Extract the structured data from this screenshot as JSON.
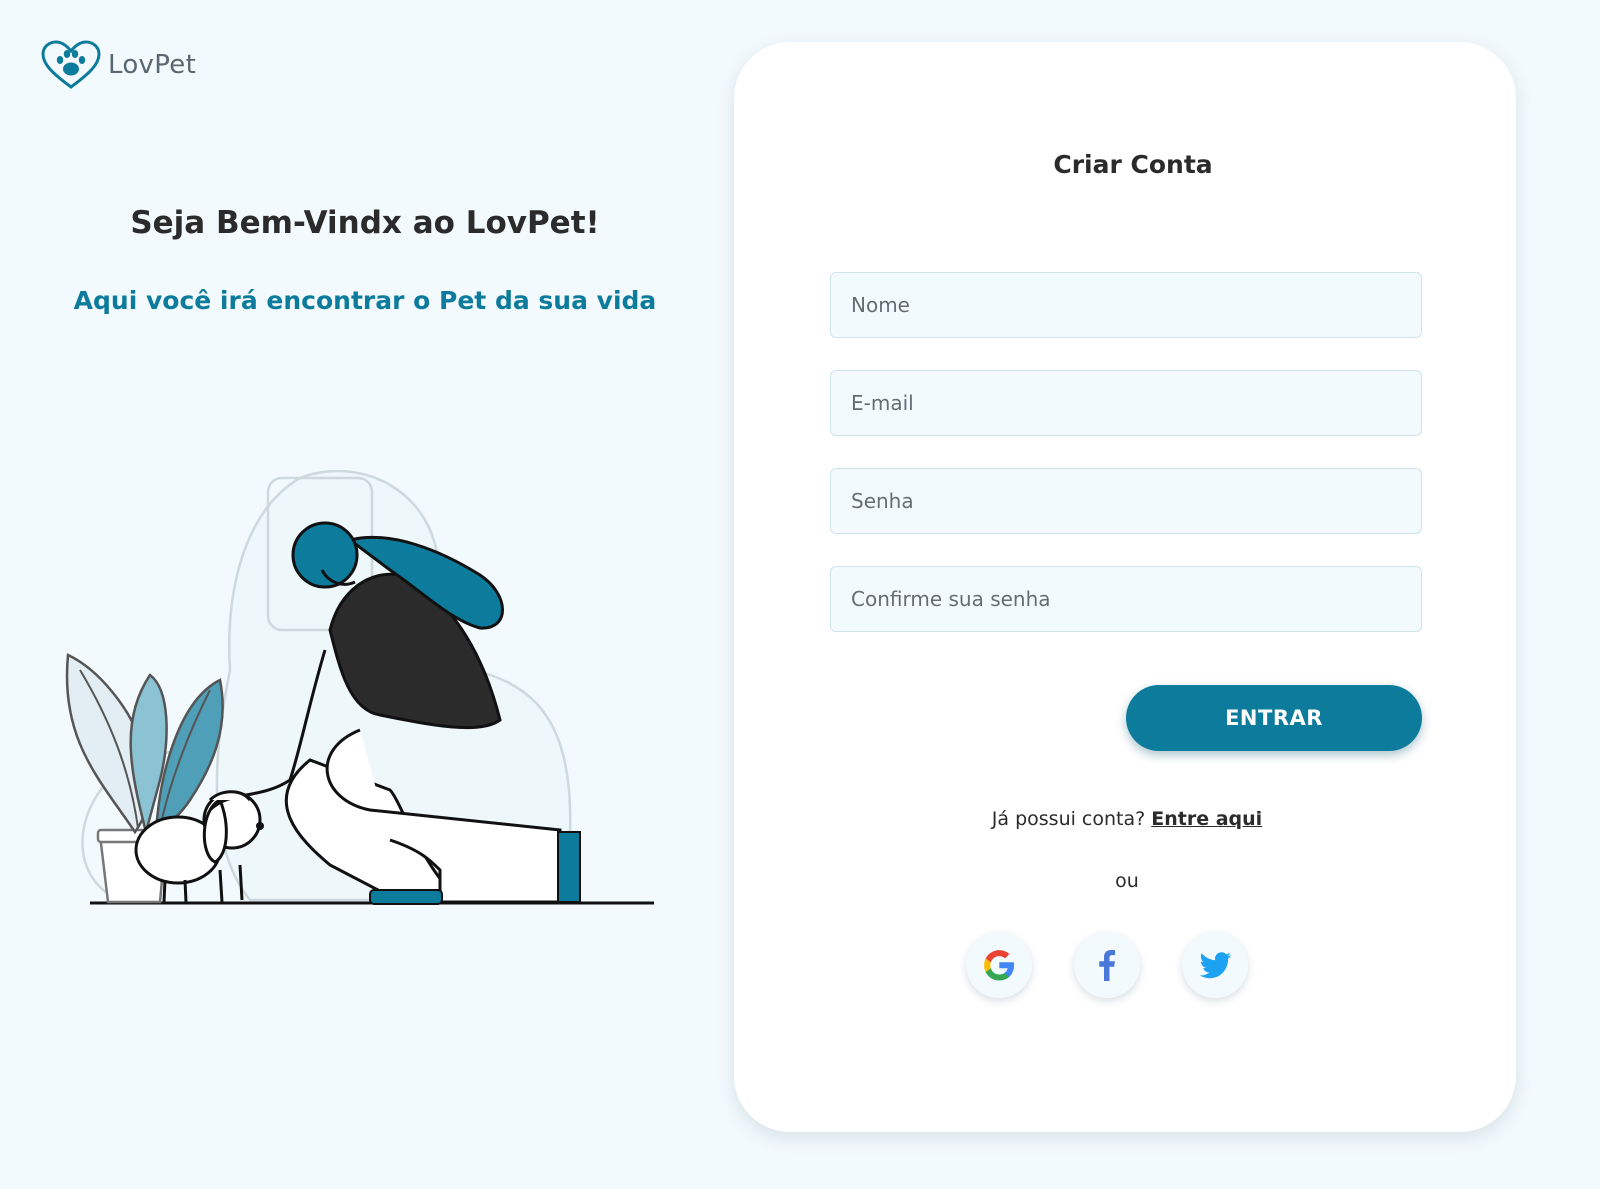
{
  "brand": {
    "name": "LovPet",
    "color": "#0d7b9b"
  },
  "welcome": {
    "title": "Seja Bem-Vindx ao LovPet!",
    "subtitle": "Aqui você irá encontrar o Pet da sua vida"
  },
  "form": {
    "title": "Criar Conta",
    "fields": [
      {
        "placeholder": "Nome",
        "value": ""
      },
      {
        "placeholder": "E-mail",
        "value": ""
      },
      {
        "placeholder": "Senha",
        "value": ""
      },
      {
        "placeholder": "Confirme sua senha",
        "value": ""
      }
    ],
    "submit_label": "ENTRAR",
    "login_prompt": "Já possui conta?",
    "login_link": "Entre aqui",
    "or_label": "ou",
    "social": [
      {
        "icon": "google-icon"
      },
      {
        "icon": "facebook-icon"
      },
      {
        "icon": "twitter-icon"
      }
    ]
  }
}
